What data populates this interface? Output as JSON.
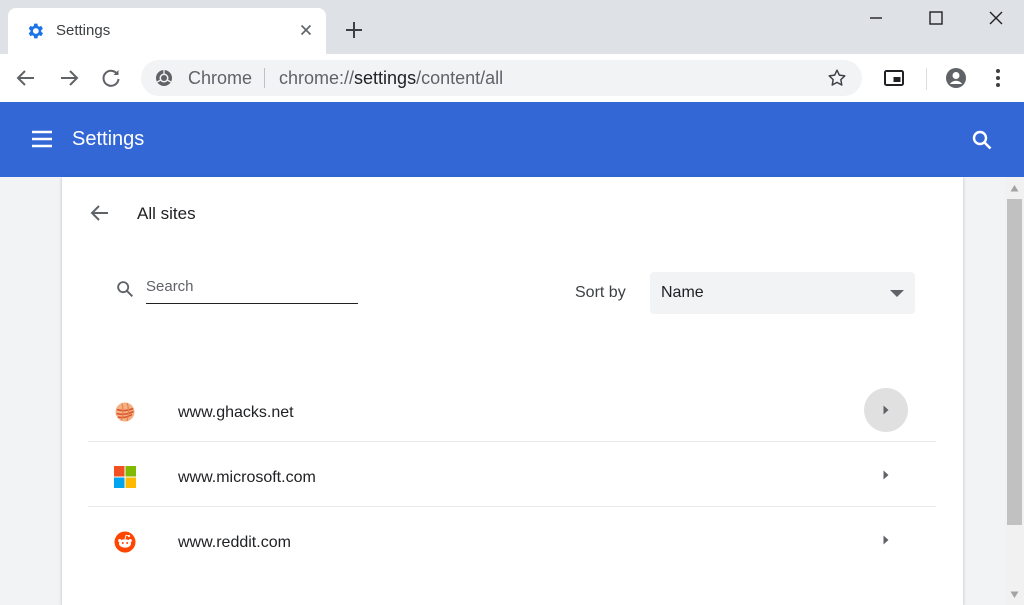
{
  "tab": {
    "title": "Settings",
    "icon": "gear-icon"
  },
  "omnibox": {
    "chip_label": "Chrome",
    "url_prefix": "chrome://",
    "url_host": "settings",
    "url_path": "/content/all"
  },
  "settings_header": {
    "title": "Settings"
  },
  "page": {
    "title": "All sites",
    "search_placeholder": "Search",
    "sort_label": "Sort by",
    "sort_value": "Name"
  },
  "sites": [
    {
      "name": "www.ghacks.net",
      "icon": "ghacks-favicon"
    },
    {
      "name": "www.microsoft.com",
      "icon": "microsoft-favicon"
    },
    {
      "name": "www.reddit.com",
      "icon": "reddit-favicon"
    }
  ],
  "colors": {
    "header": "#3367d6",
    "tab_gear": "#1a73e8",
    "reddit": "#ff4500",
    "ms_red": "#f25022",
    "ms_green": "#7fba00",
    "ms_blue": "#00a4ef",
    "ms_yellow": "#ffb900"
  }
}
